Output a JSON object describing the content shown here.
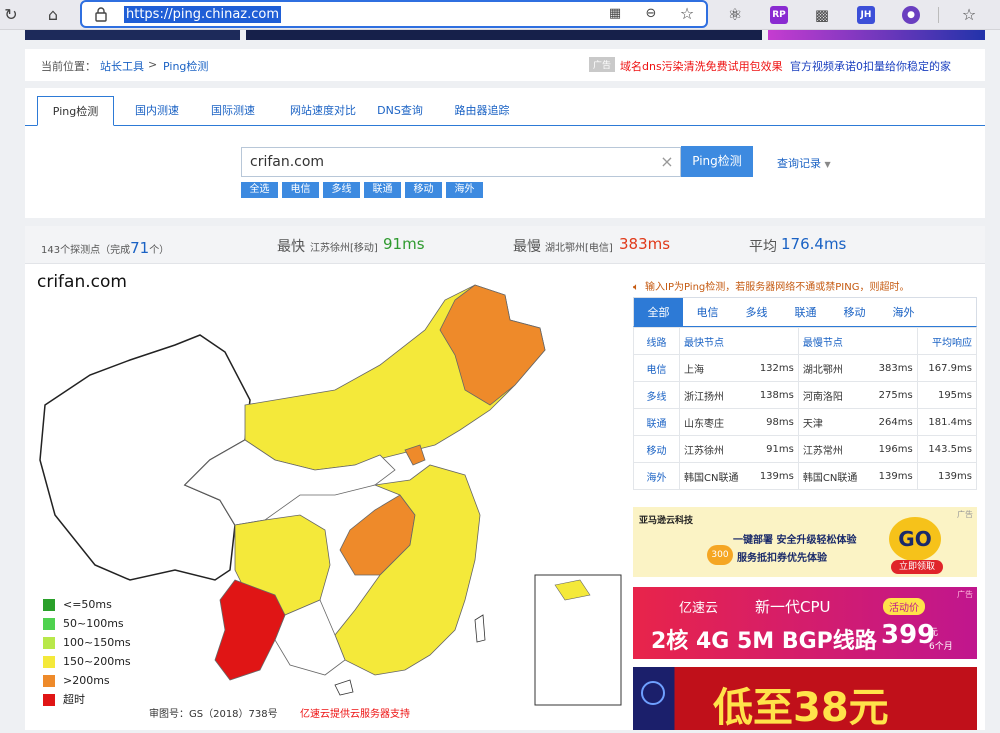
{
  "browser": {
    "url": "https://ping.chinaz.com"
  },
  "breadcrumb": {
    "current_label": "当前位置：",
    "tools_link": "站长工具",
    "separator": ">",
    "page_link": "Ping检测",
    "ad_badge": "广告",
    "ad_link_1": "域名dns污染清洗免费试用包效果",
    "ad_link_2": "官方视频承诺0扣量给你稳定的家"
  },
  "tabs": [
    "Ping检测",
    "国内测速",
    "国际测速",
    "网站速度对比",
    "DNS查询",
    "路由器追踪"
  ],
  "search": {
    "value": "crifan.com",
    "clear_icon": "×",
    "button": "Ping检测",
    "history": "查询记录"
  },
  "filters": [
    "全选",
    "电信",
    "多线",
    "联通",
    "移动",
    "海外"
  ],
  "stats": {
    "nodes_prefix": "143个探测点（完成",
    "completed": "71",
    "nodes_suffix": "个）",
    "fastest_label": "最快",
    "fastest_node": "江苏徐州[移动]",
    "fastest_value": "91ms",
    "slowest_label": "最慢",
    "slowest_node": "湖北鄂州[电信]",
    "slowest_value": "383ms",
    "avg_label": "平均",
    "avg_value": "176.4ms"
  },
  "map": {
    "title": "crifan.com",
    "legend": [
      {
        "label": "<=50ms",
        "color": "#2aa02a"
      },
      {
        "label": "50~100ms",
        "color": "#4fd24f"
      },
      {
        "label": "100~150ms",
        "color": "#b8e84a"
      },
      {
        "label": "150~200ms",
        "color": "#f4e93a"
      },
      {
        "label": ">200ms",
        "color": "#ee8a2a"
      },
      {
        "label": "超时",
        "color": "#e01515"
      }
    ],
    "approval": "审图号：GS（2018）738号",
    "sponsor": "亿速云提供云服务器支持"
  },
  "results": {
    "notice": "输入IP为Ping检测，若服务器网络不通或禁PING，则超时。",
    "tabs": [
      "全部",
      "电信",
      "多线",
      "联通",
      "移动",
      "海外"
    ],
    "headers": [
      "线路",
      "最快节点",
      "最慢节点",
      "平均响应"
    ],
    "rows": [
      {
        "line": "电信",
        "fast_node": "上海",
        "fast_ms": "132ms",
        "slow_node": "湖北鄂州",
        "slow_ms": "383ms",
        "avg": "167.9ms"
      },
      {
        "line": "多线",
        "fast_node": "浙江扬州",
        "fast_ms": "138ms",
        "slow_node": "河南洛阳",
        "slow_ms": "275ms",
        "avg": "195ms"
      },
      {
        "line": "联通",
        "fast_node": "山东枣庄",
        "fast_ms": "98ms",
        "slow_node": "天津",
        "slow_ms": "264ms",
        "avg": "181.4ms"
      },
      {
        "line": "移动",
        "fast_node": "江苏徐州",
        "fast_ms": "91ms",
        "slow_node": "江苏常州",
        "slow_ms": "196ms",
        "avg": "143.5ms"
      },
      {
        "line": "海外",
        "fast_node": "韩国CN联通",
        "fast_ms": "139ms",
        "slow_node": "韩国CN联通",
        "slow_ms": "139ms",
        "avg": "139ms"
      }
    ]
  },
  "ads": {
    "ad1_brand": "亚马逊云科技",
    "ad1_text1": "一键部署  安全升级轻松体验",
    "ad1_text2": "服务抵扣券优先体验",
    "ad1_badge": "300",
    "ad1_go": "GO",
    "ad1_cta": "立即领取",
    "ad2_brand": "亿速云",
    "ad2_line1": "新一代CPU",
    "ad2_tag": "活动价",
    "ad2_line2": "2核 4G 5M BGP线路",
    "ad2_price": "399",
    "ad2_unit": "元",
    "ad2_period": "6个月",
    "ad3_text": "低至38元",
    "ad_badge": "广告"
  }
}
